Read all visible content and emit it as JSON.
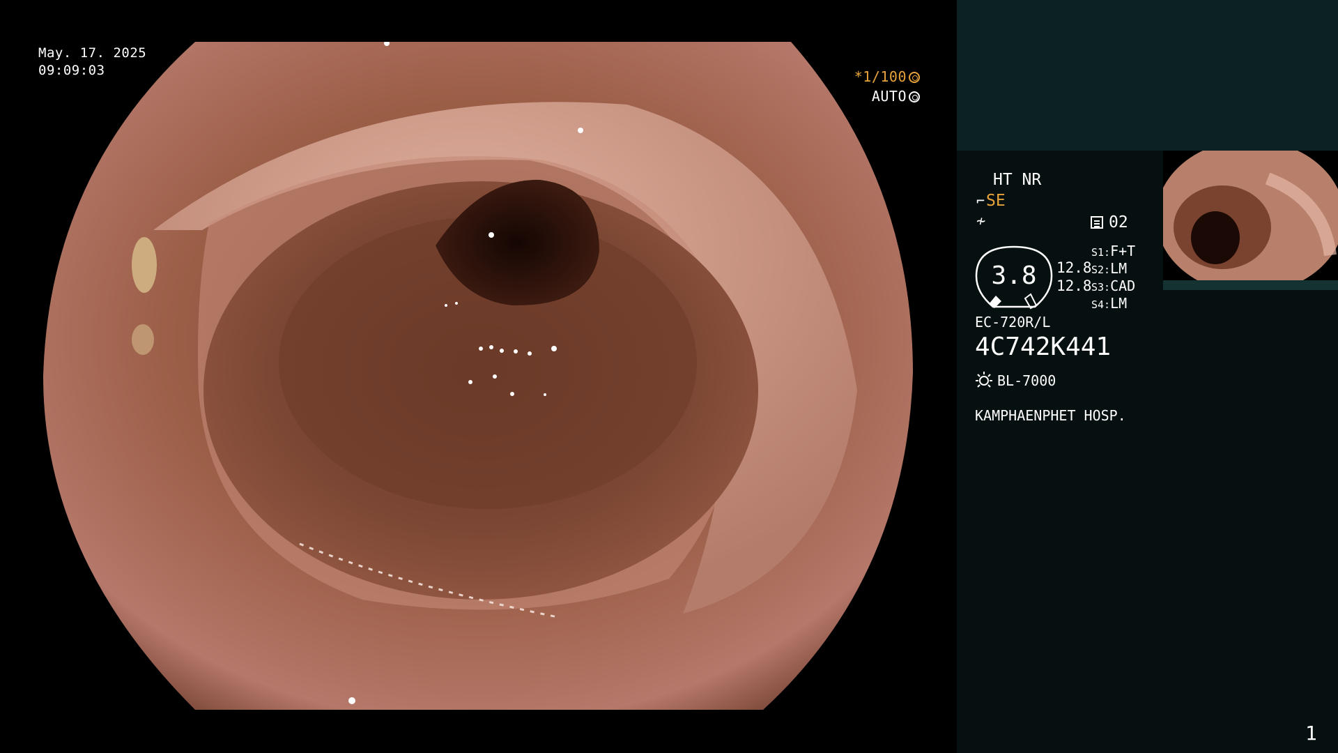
{
  "scope_view": {
    "date": "May. 17. 2025",
    "time": "09:09:03",
    "shutter_speed": "*1/100",
    "iris_mode": "AUTO",
    "colors": {
      "mucosa": "#a2654f",
      "lumen": "#1f0b06",
      "background": "#000000"
    }
  },
  "info_panel": {
    "image_mode_1": "HT NR",
    "enhancement": "SE",
    "record_count": "02",
    "gauge_value": "3.8",
    "gauge_line_1": "12.8",
    "gauge_line_2": "12.8",
    "switches": [
      {
        "key": "S1:",
        "value": "F+T"
      },
      {
        "key": "S2:",
        "value": "LM"
      },
      {
        "key": "S3:",
        "value": "CAD"
      },
      {
        "key": "S4:",
        "value": "LM"
      }
    ],
    "scope_model": "EC-720R/L",
    "scope_serial": "4C742K441",
    "light_source": "BL-7000",
    "hospital": "KAMPHAENPHET HOSP.",
    "page_number": "1",
    "colors": {
      "panel_bg": "#071011",
      "panel_top": "#0c2222",
      "accent": "#e8a43a"
    }
  }
}
